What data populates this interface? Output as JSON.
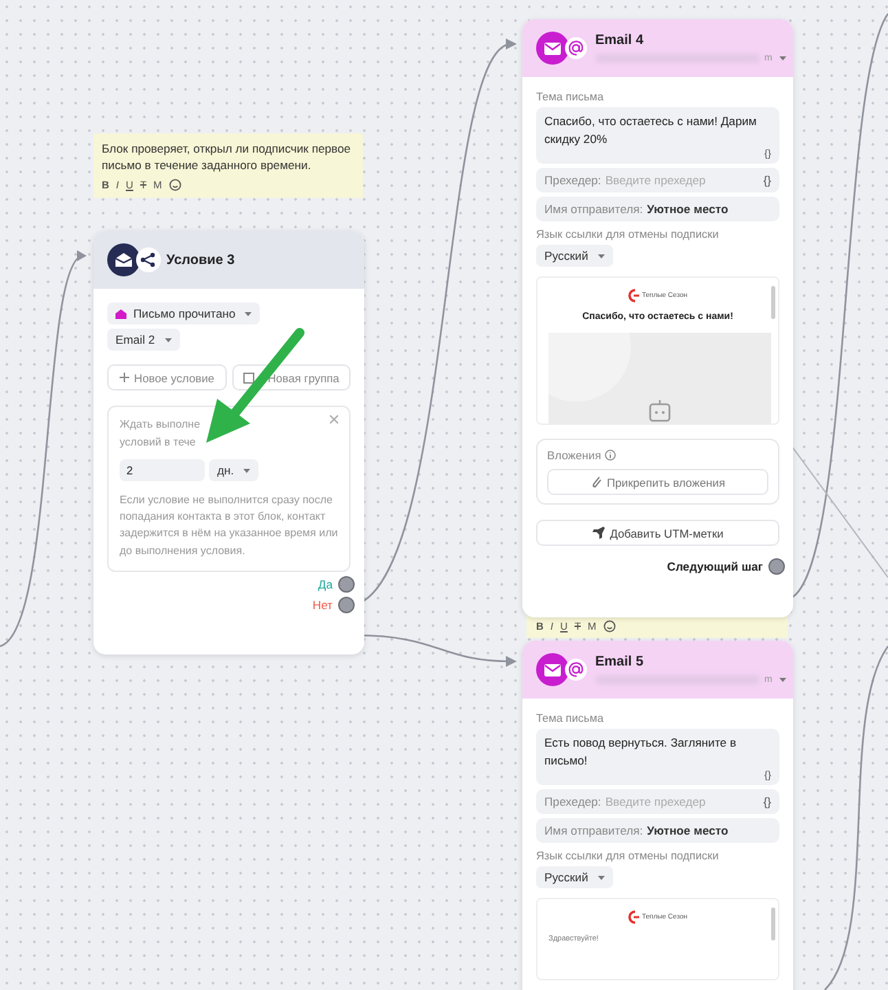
{
  "notes": [
    {
      "text": "Блок проверяет, открыл ли подписчик первое письмо в течение заданного времени.",
      "toolbar": [
        {
          "kind": "bold",
          "label": "B"
        },
        {
          "kind": "italic",
          "label": "I"
        },
        {
          "kind": "underline",
          "label": "U"
        },
        {
          "kind": "strike",
          "label": "T"
        },
        {
          "kind": "plain",
          "label": "M"
        },
        {
          "kind": "emoji"
        }
      ]
    },
    {
      "toolbar": [
        {
          "kind": "bold",
          "label": "B"
        },
        {
          "kind": "italic",
          "label": "I"
        },
        {
          "kind": "underline",
          "label": "U"
        },
        {
          "kind": "strike",
          "label": "T"
        },
        {
          "kind": "plain",
          "label": "M"
        },
        {
          "kind": "emoji"
        }
      ]
    }
  ],
  "condition": {
    "title": "Условие 3",
    "event": "Письмо прочитано",
    "email": "Email 2",
    "buttons": [
      {
        "kind": "plus",
        "label": "Новое условие"
      },
      {
        "kind": "group",
        "label": "Новая группа"
      }
    ],
    "wait": {
      "label_lines": [
        "Ждать выполне",
        "условий в тече"
      ],
      "value": "2",
      "unit": "дн.",
      "hint": "Если условие не выполнится сразу после попадания контакта в этот блок, контакт задержится в нём на указанное время или до выполнения условия."
    },
    "outputs": [
      {
        "kind": "yes",
        "label": "Да"
      },
      {
        "kind": "no",
        "label": "Нет"
      }
    ]
  },
  "emails": [
    {
      "title": "Email 4",
      "suffix": "m",
      "subject_label": "Тема письма",
      "subject": "Спасибо, что остаетесь с нами! Дарим скидку 20%",
      "var_token": "{}",
      "preheader_label": "Прехедер:",
      "preheader_placeholder": "Введите прехедер",
      "preheader_token": "{}",
      "sender_label": "Имя отправителя:",
      "sender": "Уютное место",
      "unsub_label": "Язык ссылки для отмены подписки",
      "language": "Русский",
      "preview": {
        "brand": "Теплые Сезон",
        "heading": "Спасибо, что остаетесь с нами!"
      },
      "attachments_label": "Вложения",
      "attach_button": "Прикрепить вложения",
      "utm_button": "Добавить UTM-метки",
      "next_step": "Следующий шаг"
    },
    {
      "title": "Email 5",
      "suffix": "m",
      "subject_label": "Тема письма",
      "subject": "Есть повод вернуться. Загляните в письмо!",
      "var_token": "{}",
      "preheader_label": "Прехедер:",
      "preheader_placeholder": "Введите прехедер",
      "preheader_token": "{}",
      "sender_label": "Имя отправителя:",
      "sender": "Уютное место",
      "unsub_label": "Язык ссылки для отмены подписки",
      "language": "Русский",
      "preview": {
        "brand": "Теплые Сезон",
        "greeting": "Здравствуйте!"
      }
    }
  ]
}
